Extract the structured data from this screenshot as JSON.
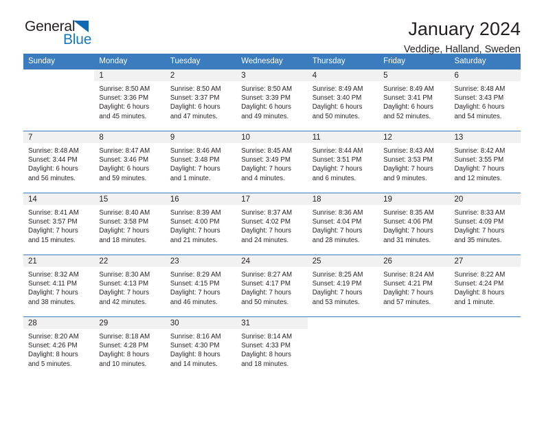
{
  "logo": {
    "word_general": "General",
    "word_blue": "Blue",
    "triangle_color": "#1268b3",
    "blue_color": "#1479c4"
  },
  "header": {
    "title": "January 2024",
    "subtitle": "Veddige, Halland, Sweden"
  },
  "theme": {
    "header_bg": "#3a7cbe",
    "daynum_bg": "#f1f1f1",
    "text": "#231f20"
  },
  "weekday_headers": [
    "Sunday",
    "Monday",
    "Tuesday",
    "Wednesday",
    "Thursday",
    "Friday",
    "Saturday"
  ],
  "weeks": [
    [
      {
        "day": "",
        "sunrise": "",
        "sunset": "",
        "daylight1": "",
        "daylight2": ""
      },
      {
        "day": "1",
        "sunrise": "Sunrise: 8:50 AM",
        "sunset": "Sunset: 3:36 PM",
        "daylight1": "Daylight: 6 hours",
        "daylight2": "and 45 minutes."
      },
      {
        "day": "2",
        "sunrise": "Sunrise: 8:50 AM",
        "sunset": "Sunset: 3:37 PM",
        "daylight1": "Daylight: 6 hours",
        "daylight2": "and 47 minutes."
      },
      {
        "day": "3",
        "sunrise": "Sunrise: 8:50 AM",
        "sunset": "Sunset: 3:39 PM",
        "daylight1": "Daylight: 6 hours",
        "daylight2": "and 49 minutes."
      },
      {
        "day": "4",
        "sunrise": "Sunrise: 8:49 AM",
        "sunset": "Sunset: 3:40 PM",
        "daylight1": "Daylight: 6 hours",
        "daylight2": "and 50 minutes."
      },
      {
        "day": "5",
        "sunrise": "Sunrise: 8:49 AM",
        "sunset": "Sunset: 3:41 PM",
        "daylight1": "Daylight: 6 hours",
        "daylight2": "and 52 minutes."
      },
      {
        "day": "6",
        "sunrise": "Sunrise: 8:48 AM",
        "sunset": "Sunset: 3:43 PM",
        "daylight1": "Daylight: 6 hours",
        "daylight2": "and 54 minutes."
      }
    ],
    [
      {
        "day": "7",
        "sunrise": "Sunrise: 8:48 AM",
        "sunset": "Sunset: 3:44 PM",
        "daylight1": "Daylight: 6 hours",
        "daylight2": "and 56 minutes."
      },
      {
        "day": "8",
        "sunrise": "Sunrise: 8:47 AM",
        "sunset": "Sunset: 3:46 PM",
        "daylight1": "Daylight: 6 hours",
        "daylight2": "and 59 minutes."
      },
      {
        "day": "9",
        "sunrise": "Sunrise: 8:46 AM",
        "sunset": "Sunset: 3:48 PM",
        "daylight1": "Daylight: 7 hours",
        "daylight2": "and 1 minute."
      },
      {
        "day": "10",
        "sunrise": "Sunrise: 8:45 AM",
        "sunset": "Sunset: 3:49 PM",
        "daylight1": "Daylight: 7 hours",
        "daylight2": "and 4 minutes."
      },
      {
        "day": "11",
        "sunrise": "Sunrise: 8:44 AM",
        "sunset": "Sunset: 3:51 PM",
        "daylight1": "Daylight: 7 hours",
        "daylight2": "and 6 minutes."
      },
      {
        "day": "12",
        "sunrise": "Sunrise: 8:43 AM",
        "sunset": "Sunset: 3:53 PM",
        "daylight1": "Daylight: 7 hours",
        "daylight2": "and 9 minutes."
      },
      {
        "day": "13",
        "sunrise": "Sunrise: 8:42 AM",
        "sunset": "Sunset: 3:55 PM",
        "daylight1": "Daylight: 7 hours",
        "daylight2": "and 12 minutes."
      }
    ],
    [
      {
        "day": "14",
        "sunrise": "Sunrise: 8:41 AM",
        "sunset": "Sunset: 3:57 PM",
        "daylight1": "Daylight: 7 hours",
        "daylight2": "and 15 minutes."
      },
      {
        "day": "15",
        "sunrise": "Sunrise: 8:40 AM",
        "sunset": "Sunset: 3:58 PM",
        "daylight1": "Daylight: 7 hours",
        "daylight2": "and 18 minutes."
      },
      {
        "day": "16",
        "sunrise": "Sunrise: 8:39 AM",
        "sunset": "Sunset: 4:00 PM",
        "daylight1": "Daylight: 7 hours",
        "daylight2": "and 21 minutes."
      },
      {
        "day": "17",
        "sunrise": "Sunrise: 8:37 AM",
        "sunset": "Sunset: 4:02 PM",
        "daylight1": "Daylight: 7 hours",
        "daylight2": "and 24 minutes."
      },
      {
        "day": "18",
        "sunrise": "Sunrise: 8:36 AM",
        "sunset": "Sunset: 4:04 PM",
        "daylight1": "Daylight: 7 hours",
        "daylight2": "and 28 minutes."
      },
      {
        "day": "19",
        "sunrise": "Sunrise: 8:35 AM",
        "sunset": "Sunset: 4:06 PM",
        "daylight1": "Daylight: 7 hours",
        "daylight2": "and 31 minutes."
      },
      {
        "day": "20",
        "sunrise": "Sunrise: 8:33 AM",
        "sunset": "Sunset: 4:09 PM",
        "daylight1": "Daylight: 7 hours",
        "daylight2": "and 35 minutes."
      }
    ],
    [
      {
        "day": "21",
        "sunrise": "Sunrise: 8:32 AM",
        "sunset": "Sunset: 4:11 PM",
        "daylight1": "Daylight: 7 hours",
        "daylight2": "and 38 minutes."
      },
      {
        "day": "22",
        "sunrise": "Sunrise: 8:30 AM",
        "sunset": "Sunset: 4:13 PM",
        "daylight1": "Daylight: 7 hours",
        "daylight2": "and 42 minutes."
      },
      {
        "day": "23",
        "sunrise": "Sunrise: 8:29 AM",
        "sunset": "Sunset: 4:15 PM",
        "daylight1": "Daylight: 7 hours",
        "daylight2": "and 46 minutes."
      },
      {
        "day": "24",
        "sunrise": "Sunrise: 8:27 AM",
        "sunset": "Sunset: 4:17 PM",
        "daylight1": "Daylight: 7 hours",
        "daylight2": "and 50 minutes."
      },
      {
        "day": "25",
        "sunrise": "Sunrise: 8:25 AM",
        "sunset": "Sunset: 4:19 PM",
        "daylight1": "Daylight: 7 hours",
        "daylight2": "and 53 minutes."
      },
      {
        "day": "26",
        "sunrise": "Sunrise: 8:24 AM",
        "sunset": "Sunset: 4:21 PM",
        "daylight1": "Daylight: 7 hours",
        "daylight2": "and 57 minutes."
      },
      {
        "day": "27",
        "sunrise": "Sunrise: 8:22 AM",
        "sunset": "Sunset: 4:24 PM",
        "daylight1": "Daylight: 8 hours",
        "daylight2": "and 1 minute."
      }
    ],
    [
      {
        "day": "28",
        "sunrise": "Sunrise: 8:20 AM",
        "sunset": "Sunset: 4:26 PM",
        "daylight1": "Daylight: 8 hours",
        "daylight2": "and 5 minutes."
      },
      {
        "day": "29",
        "sunrise": "Sunrise: 8:18 AM",
        "sunset": "Sunset: 4:28 PM",
        "daylight1": "Daylight: 8 hours",
        "daylight2": "and 10 minutes."
      },
      {
        "day": "30",
        "sunrise": "Sunrise: 8:16 AM",
        "sunset": "Sunset: 4:30 PM",
        "daylight1": "Daylight: 8 hours",
        "daylight2": "and 14 minutes."
      },
      {
        "day": "31",
        "sunrise": "Sunrise: 8:14 AM",
        "sunset": "Sunset: 4:33 PM",
        "daylight1": "Daylight: 8 hours",
        "daylight2": "and 18 minutes."
      },
      {
        "day": "",
        "sunrise": "",
        "sunset": "",
        "daylight1": "",
        "daylight2": ""
      },
      {
        "day": "",
        "sunrise": "",
        "sunset": "",
        "daylight1": "",
        "daylight2": ""
      },
      {
        "day": "",
        "sunrise": "",
        "sunset": "",
        "daylight1": "",
        "daylight2": ""
      }
    ]
  ]
}
